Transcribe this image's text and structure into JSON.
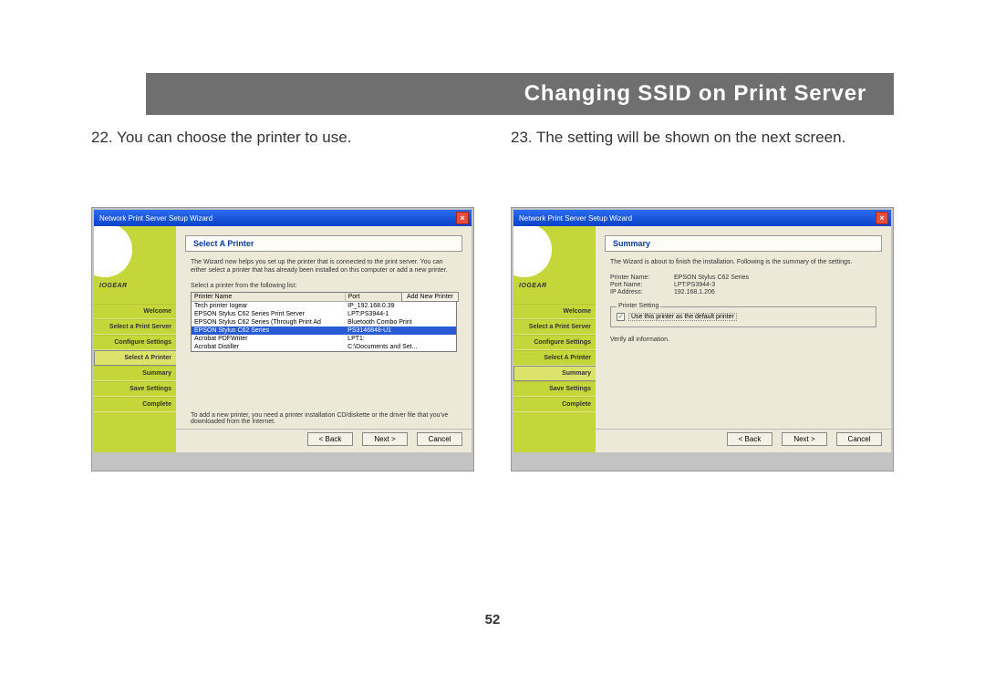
{
  "page": {
    "header_title": "Changing SSID on Print Server",
    "number": "52"
  },
  "left": {
    "caption": "22. You can choose the printer to use.",
    "window_title": "Network Print Server Setup Wizard",
    "panel_title": "Select A Printer",
    "desc": "The Wizard now helps you set up the printer that is connected to the print server. You can either select a printer that has already been installed on this computer or add a new printer.",
    "list_label": "Select a printer from the following list:",
    "add_new": "Add New Printer",
    "cols": {
      "c1": "Printer Name",
      "c2": "Port"
    },
    "rows": [
      {
        "name": "Tech printer Iogear",
        "port": "IP_192.168.0.39"
      },
      {
        "name": "EPSON Stylus C62 Series Print Server",
        "port": "LPT:PS3944-1"
      },
      {
        "name": "EPSON Stylus C62 Series (Through Print Ad",
        "port": "Bluetooth Combo Print"
      },
      {
        "name": "EPSON Stylus C62 Series",
        "port": "PS3146848-U1"
      },
      {
        "name": "Acrobat PDFWriter",
        "port": "LPT1:"
      },
      {
        "name": "Acrobat Distiller",
        "port": "C:\\Documents and Set..."
      }
    ],
    "selected_index": 3,
    "hint": "To add a new printer, you need a printer installation CD/diskette or the driver file that you've downloaded from the Internet.",
    "sidebar_items": [
      "Welcome",
      "Select a Print Server",
      "Configure Settings",
      "Select A Printer",
      "Summary",
      "Save Settings",
      "Complete"
    ],
    "sidebar_active_index": 3,
    "brand": "IOGEAR"
  },
  "right": {
    "caption": "23. The setting will be shown on the next screen.",
    "window_title": "Network Print Server Setup Wizard",
    "panel_title": "Summary",
    "desc": "The Wizard is about to finish the installation. Following is the summary of the settings.",
    "summary": [
      {
        "k": "Printer Name:",
        "v": "EPSON Stylus C62 Series"
      },
      {
        "k": "Port Name:",
        "v": "LPT:PS3944-3"
      },
      {
        "k": "IP Address:",
        "v": "192.168.1.206"
      }
    ],
    "fieldset_legend": "Printer Setting",
    "checkbox_label": "Use this printer as the default printer",
    "verify": "Verify all information.",
    "sidebar_items": [
      "Welcome",
      "Select a Print Server",
      "Configure Settings",
      "Select A Printer",
      "Summary",
      "Save Settings",
      "Complete"
    ],
    "sidebar_active_index": 4,
    "brand": "IOGEAR"
  },
  "buttons": {
    "back": "< Back",
    "next": "Next >",
    "cancel": "Cancel"
  }
}
